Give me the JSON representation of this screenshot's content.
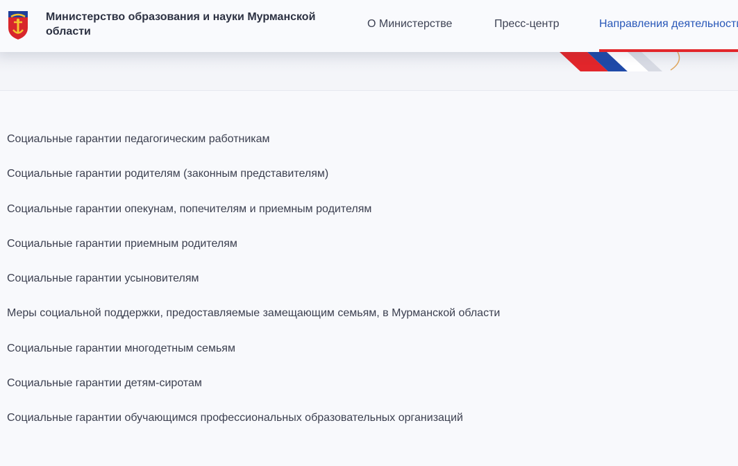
{
  "header": {
    "org_name": "Министерство образования и науки Мурманской области",
    "nav": [
      {
        "label": "О Министерстве"
      },
      {
        "label": "Пресс-центр"
      },
      {
        "label": "Направления деятельности"
      }
    ],
    "active_index": 2,
    "colors": {
      "active_link": "#2857b8",
      "underline": "#e2262b",
      "flag_white": "#ffffff",
      "flag_blue": "#1f4aa8",
      "flag_red": "#e2262b"
    }
  },
  "items": [
    {
      "label": "Социальные гарантии педагогическим работникам"
    },
    {
      "label": "Социальные гарантии родителям (законным представителям)"
    },
    {
      "label": "Социальные гарантии опекунам, попечителям и приемным родителям"
    },
    {
      "label": "Социальные гарантии приемным родителям"
    },
    {
      "label": "Социальные гарантии усыновителям"
    },
    {
      "label": "Меры социальной поддержки, предоставляемые замещающим семьям, в Мурманской области"
    },
    {
      "label": "Социальные гарантии многодетным семьям"
    },
    {
      "label": "Социальные гарантии детям-сиротам"
    },
    {
      "label": "Социальные гарантии обучающимся профессиональных образовательных организаций"
    }
  ],
  "icons": {
    "emblem": "murmansk-coat-of-arms-icon"
  }
}
